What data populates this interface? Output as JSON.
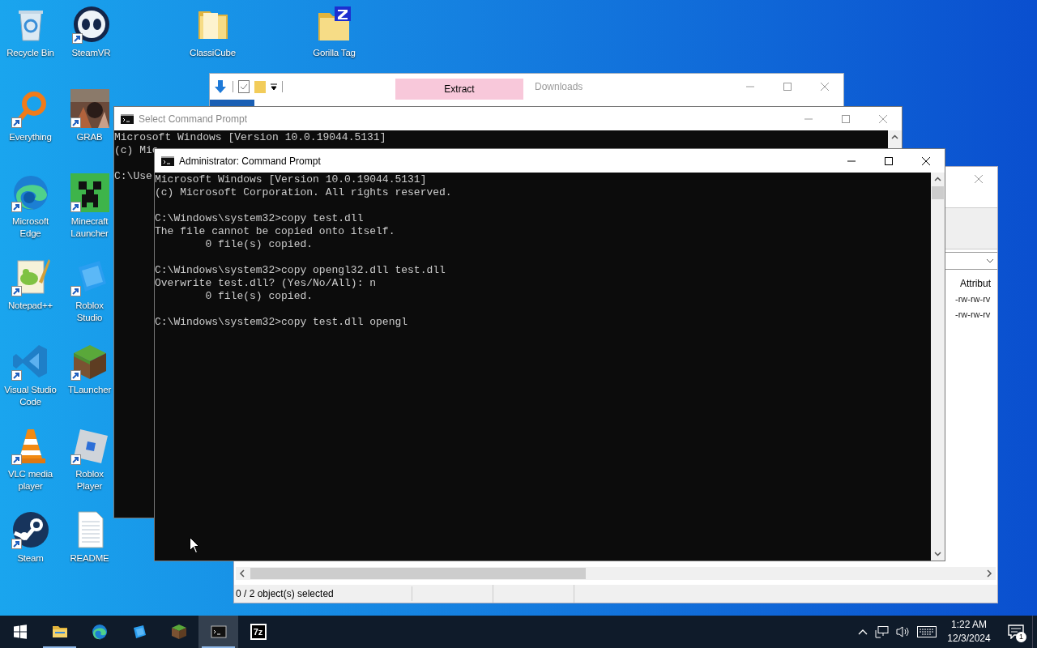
{
  "desktop": {
    "icons": [
      {
        "label": "Recycle Bin",
        "kind": "recycle",
        "shortcut": false
      },
      {
        "label": "SteamVR",
        "kind": "vr",
        "shortcut": true
      },
      {
        "label": "ClassiCube",
        "kind": "folder",
        "shortcut": false
      },
      {
        "label": "Gorilla Tag",
        "kind": "folder_zip",
        "shortcut": false
      },
      {
        "label": "Everything",
        "kind": "magnifier",
        "shortcut": true
      },
      {
        "label": "GRAB",
        "kind": "picture_app",
        "shortcut": true
      },
      {
        "label": "Microsoft Edge",
        "kind": "edge",
        "shortcut": true
      },
      {
        "label": "Minecraft Launcher",
        "kind": "creeper",
        "shortcut": true
      },
      {
        "label": "Notepad++",
        "kind": "notepad",
        "shortcut": true
      },
      {
        "label": "Roblox Studio",
        "kind": "studio",
        "shortcut": true
      },
      {
        "label": "Visual Studio Code",
        "kind": "vscode",
        "shortcut": true
      },
      {
        "label": "TLauncher",
        "kind": "grass",
        "shortcut": true
      },
      {
        "label": "VLC media player",
        "kind": "cone",
        "shortcut": true
      },
      {
        "label": "Roblox Player",
        "kind": "roblox",
        "shortcut": true
      },
      {
        "label": "Steam",
        "kind": "steam",
        "shortcut": true
      },
      {
        "label": "README",
        "kind": "document",
        "shortcut": false
      }
    ]
  },
  "explorer_window": {
    "title": "Downloads",
    "contextual_tab": "Extract",
    "active": false
  },
  "archive_window": {
    "columns": [
      "Attribut"
    ],
    "rows": [
      {
        "attributes": "-rw-rw-rv"
      },
      {
        "attributes": "-rw-rw-rv"
      }
    ],
    "status": "0 / 2 object(s) selected"
  },
  "console_windows": [
    {
      "title": "Select Command Prompt",
      "active": false,
      "blocks": [
        [
          "Microsoft Windows [Version 10.0.19044.5131]",
          "(c) Mic"
        ],
        [
          "C:\\Use"
        ]
      ]
    },
    {
      "title": "Administrator: Command Prompt",
      "active": true,
      "blocks": [
        [
          "Microsoft Windows [Version 10.0.19044.5131]",
          "(c) Microsoft Corporation. All rights reserved."
        ],
        [
          "C:\\Windows\\system32>copy test.dll",
          "The file cannot be copied onto itself.",
          "        0 file(s) copied."
        ],
        [
          "C:\\Windows\\system32>copy opengl32.dll test.dll",
          "Overwrite test.dll? (Yes/No/All): n",
          "        0 file(s) copied."
        ],
        [
          "C:\\Windows\\system32>copy test.dll opengl"
        ]
      ]
    }
  ],
  "taskbar": {
    "apps": [
      {
        "kind": "start",
        "running": false,
        "selected": false
      },
      {
        "kind": "explorer",
        "running": true,
        "selected": false
      },
      {
        "kind": "edge",
        "running": false,
        "selected": false
      },
      {
        "kind": "studio",
        "running": false,
        "selected": false
      },
      {
        "kind": "grass",
        "running": false,
        "selected": false
      },
      {
        "kind": "console",
        "running": true,
        "selected": true
      },
      {
        "kind": "archiver",
        "running": false,
        "selected": false,
        "badge": "7z"
      }
    ],
    "time": "1:22 AM",
    "date": "12/3/2024",
    "notification_count": "1"
  }
}
